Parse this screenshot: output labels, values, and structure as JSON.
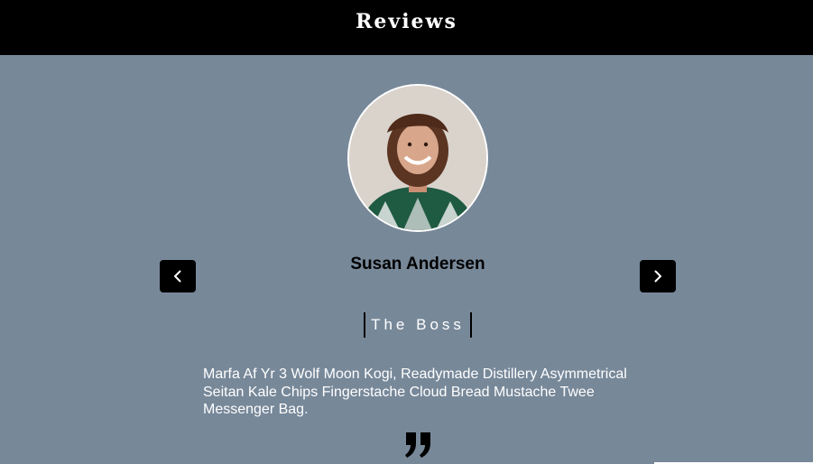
{
  "header": {
    "title": "Reviews"
  },
  "review": {
    "name": "Susan Andersen",
    "role": "The Boss",
    "text": "Marfa Af Yr 3 Wolf Moon Kogi, Readymade Distillery Asymmetrical Seitan Kale Chips Fingerstache Cloud Bread Mustache Twee Messenger Bag."
  },
  "nav": {
    "prev_icon": "chevron-left-icon",
    "next_icon": "chevron-right-icon"
  },
  "icons": {
    "quote": "quote-right-icon"
  },
  "colors": {
    "header_bg": "#000000",
    "page_bg": "#778899",
    "text_light": "#ffffff",
    "text_dark": "#000000"
  }
}
